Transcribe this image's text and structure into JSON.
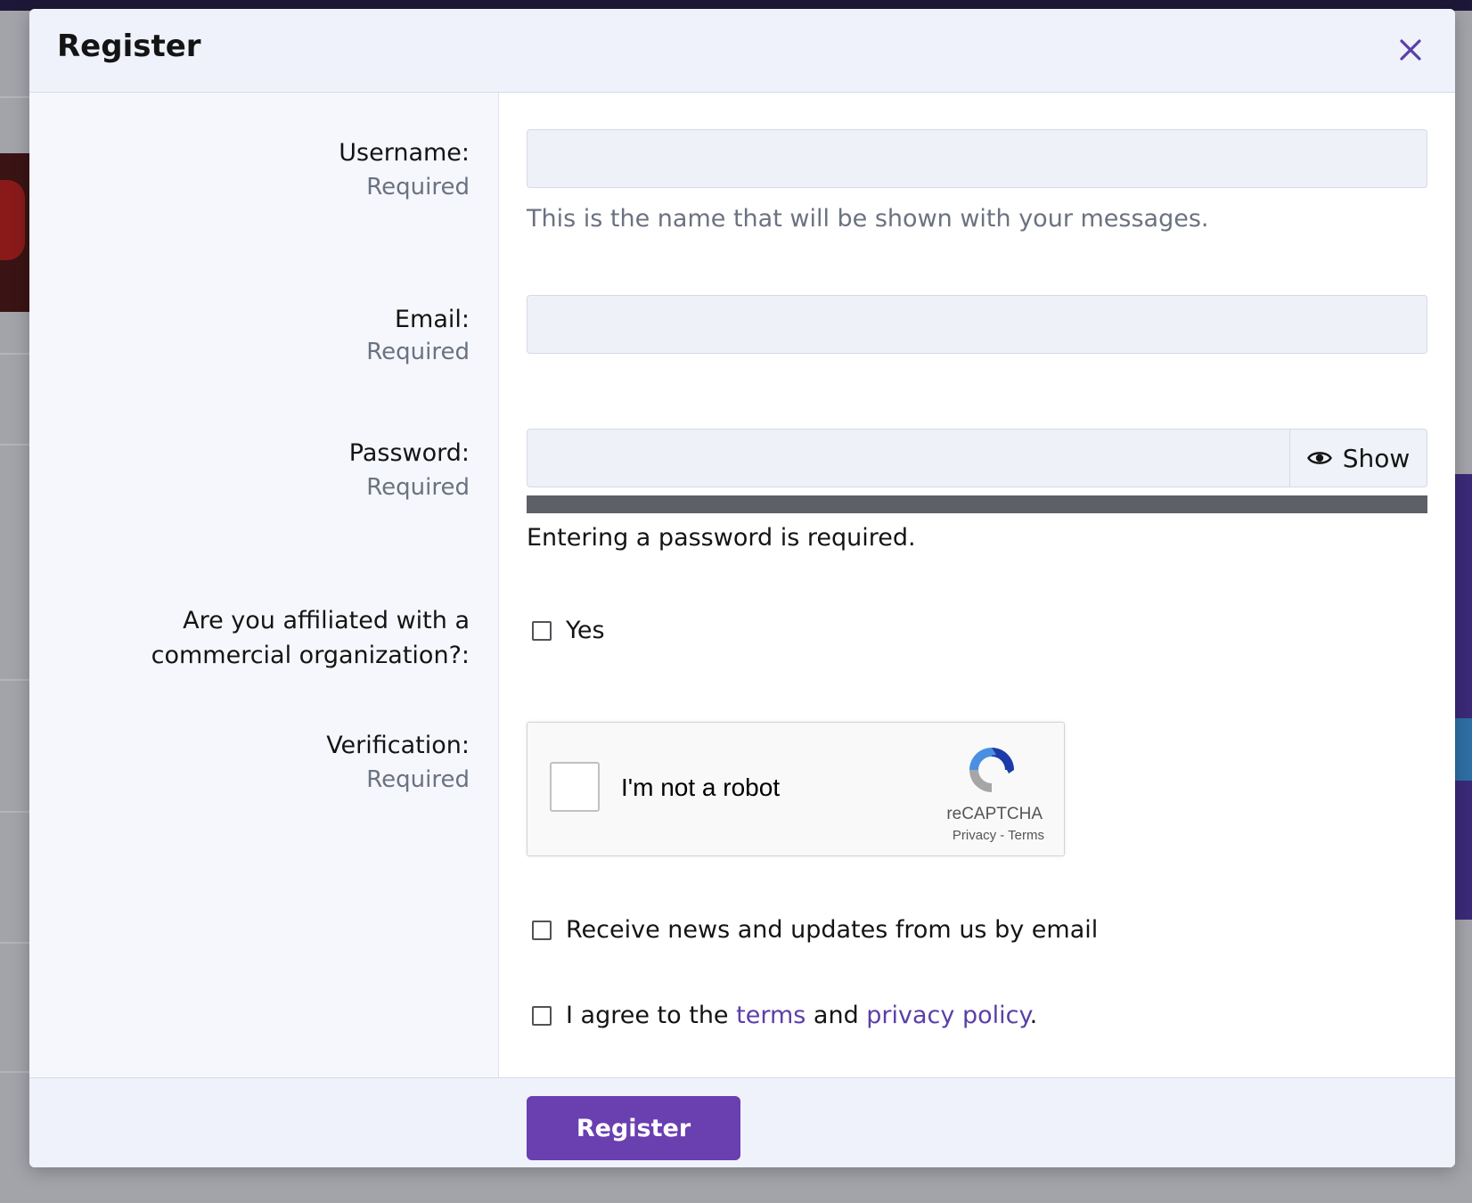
{
  "modal": {
    "title": "Register",
    "close_icon": "close-icon"
  },
  "fields": {
    "username": {
      "label": "Username:",
      "hint": "Required",
      "value": "",
      "explain": "This is the name that will be shown with your messages."
    },
    "email": {
      "label": "Email:",
      "hint": "Required",
      "value": ""
    },
    "password": {
      "label": "Password:",
      "hint": "Required",
      "value": "",
      "show_label": "Show",
      "strength_message": "Entering a password is required."
    },
    "affiliation": {
      "label": "Are you affiliated with a commercial organization?:",
      "option_label": "Yes",
      "checked": false
    },
    "verification": {
      "label": "Verification:",
      "hint": "Required",
      "recaptcha_label": "I'm not a robot",
      "recaptcha_brand": "reCAPTCHA",
      "recaptcha_privacy": "Privacy",
      "recaptcha_sep": " - ",
      "recaptcha_terms": "Terms"
    },
    "newsletter": {
      "label": "Receive news and updates from us by email",
      "checked": false
    },
    "agree": {
      "prefix": "I agree to the ",
      "terms_link": "terms",
      "middle": " and ",
      "privacy_link": "privacy policy",
      "suffix": ".",
      "checked": false
    }
  },
  "footer": {
    "submit_label": "Register"
  },
  "colors": {
    "accent": "#6a3fb0",
    "link": "#5a3fa8",
    "header_bg": "#eff2fa",
    "label_col_bg": "#f5f7fc"
  }
}
